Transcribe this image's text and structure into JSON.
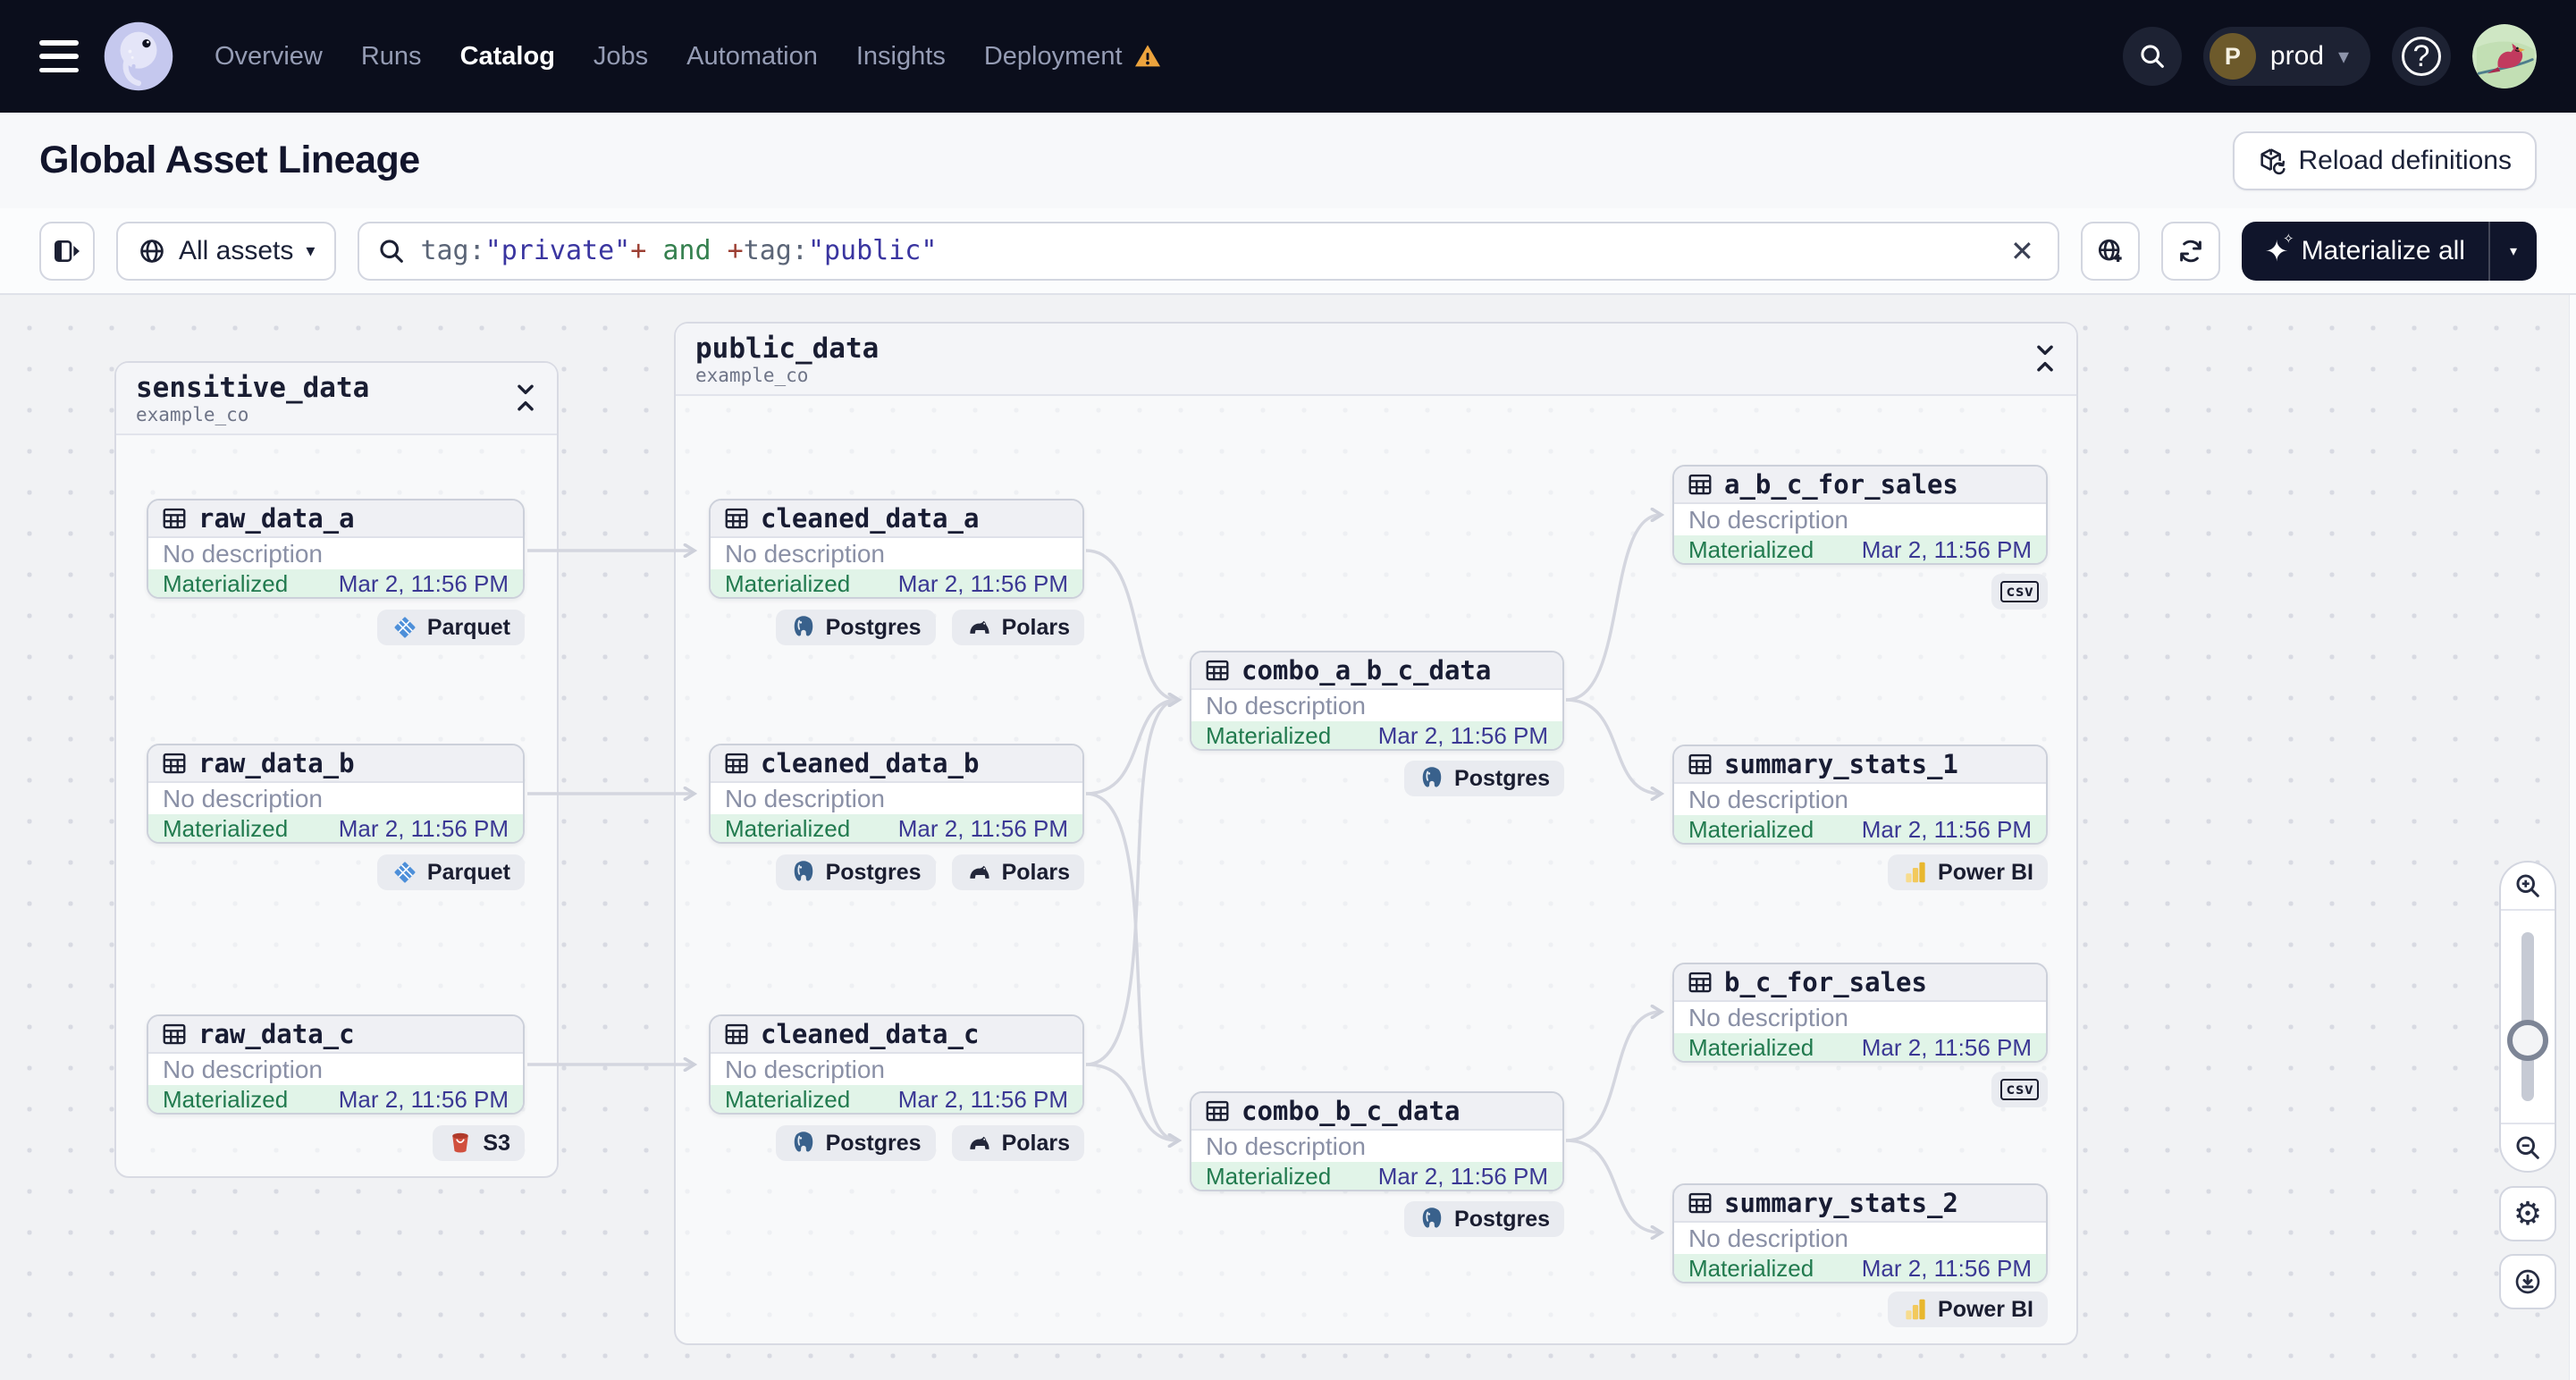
{
  "nav": {
    "logo_alt": "Dagster",
    "items": [
      {
        "label": "Overview",
        "active": false,
        "warning": false
      },
      {
        "label": "Runs",
        "active": false,
        "warning": false
      },
      {
        "label": "Catalog",
        "active": true,
        "warning": false
      },
      {
        "label": "Jobs",
        "active": false,
        "warning": false
      },
      {
        "label": "Automation",
        "active": false,
        "warning": false
      },
      {
        "label": "Insights",
        "active": false,
        "warning": false
      },
      {
        "label": "Deployment",
        "active": false,
        "warning": true
      }
    ],
    "environment": {
      "initial": "P",
      "name": "prod"
    }
  },
  "header": {
    "title": "Global Asset Lineage",
    "reload_button": "Reload definitions"
  },
  "toolbar": {
    "scope": {
      "label": "All assets"
    },
    "search": {
      "segments": [
        {
          "text": "tag:",
          "type": "key"
        },
        {
          "text": "\"private\"",
          "type": "string"
        },
        {
          "text": "+",
          "type": "op"
        },
        {
          "text": " and ",
          "type": "bool"
        },
        {
          "text": "+",
          "type": "op"
        },
        {
          "text": "tag:",
          "type": "key"
        },
        {
          "text": "\"public\"",
          "type": "string"
        }
      ]
    },
    "materialize": {
      "label": "Materialize all"
    }
  },
  "graph": {
    "groups": {
      "sensitive_data": {
        "name": "sensitive_data",
        "subtitle": "example_co"
      },
      "public_data": {
        "name": "public_data",
        "subtitle": "example_co"
      }
    },
    "nodes": {
      "raw_data_a": {
        "label": "raw_data_a",
        "description": "No description",
        "status": "Materialized",
        "timestamp": "Mar 2, 11:56 PM",
        "badges": [
          "Parquet"
        ]
      },
      "raw_data_b": {
        "label": "raw_data_b",
        "description": "No description",
        "status": "Materialized",
        "timestamp": "Mar 2, 11:56 PM",
        "badges": [
          "Parquet"
        ]
      },
      "raw_data_c": {
        "label": "raw_data_c",
        "description": "No description",
        "status": "Materialized",
        "timestamp": "Mar 2, 11:56 PM",
        "badges": [
          "S3"
        ]
      },
      "cleaned_data_a": {
        "label": "cleaned_data_a",
        "description": "No description",
        "status": "Materialized",
        "timestamp": "Mar 2, 11:56 PM",
        "badges": [
          "Postgres",
          "Polars"
        ]
      },
      "cleaned_data_b": {
        "label": "cleaned_data_b",
        "description": "No description",
        "status": "Materialized",
        "timestamp": "Mar 2, 11:56 PM",
        "badges": [
          "Postgres",
          "Polars"
        ]
      },
      "cleaned_data_c": {
        "label": "cleaned_data_c",
        "description": "No description",
        "status": "Materialized",
        "timestamp": "Mar 2, 11:56 PM",
        "badges": [
          "Postgres",
          "Polars"
        ]
      },
      "combo_a_b_c_data": {
        "label": "combo_a_b_c_data",
        "description": "No description",
        "status": "Materialized",
        "timestamp": "Mar 2, 11:56 PM",
        "badges": [
          "Postgres"
        ]
      },
      "combo_b_c_data": {
        "label": "combo_b_c_data",
        "description": "No description",
        "status": "Materialized",
        "timestamp": "Mar 2, 11:56 PM",
        "badges": [
          "Postgres"
        ]
      },
      "a_b_c_for_sales": {
        "label": "a_b_c_for_sales",
        "description": "No description",
        "status": "Materialized",
        "timestamp": "Mar 2, 11:56 PM",
        "badges": [
          "csv"
        ]
      },
      "b_c_for_sales": {
        "label": "b_c_for_sales",
        "description": "No description",
        "status": "Materialized",
        "timestamp": "Mar 2, 11:56 PM",
        "badges": [
          "csv"
        ]
      },
      "summary_stats_1": {
        "label": "summary_stats_1",
        "description": "No description",
        "status": "Materialized",
        "timestamp": "Mar 2, 11:56 PM",
        "badges": [
          "Power BI"
        ]
      },
      "summary_stats_2": {
        "label": "summary_stats_2",
        "description": "No description",
        "status": "Materialized",
        "timestamp": "Mar 2, 11:56 PM",
        "badges": [
          "Power BI"
        ]
      }
    }
  },
  "icons": {
    "close": "✕",
    "caret_down": "▾",
    "gear": "⚙",
    "question": "?",
    "sparkle": "✦",
    "sparkle_small": "✧"
  },
  "colors": {
    "status_green": "#217a4e",
    "timestamp_indigo": "#3b3894",
    "warning_orange": "#eca33d",
    "accent_dark": "#10152b",
    "nav_bg": "#0b0e1c"
  }
}
